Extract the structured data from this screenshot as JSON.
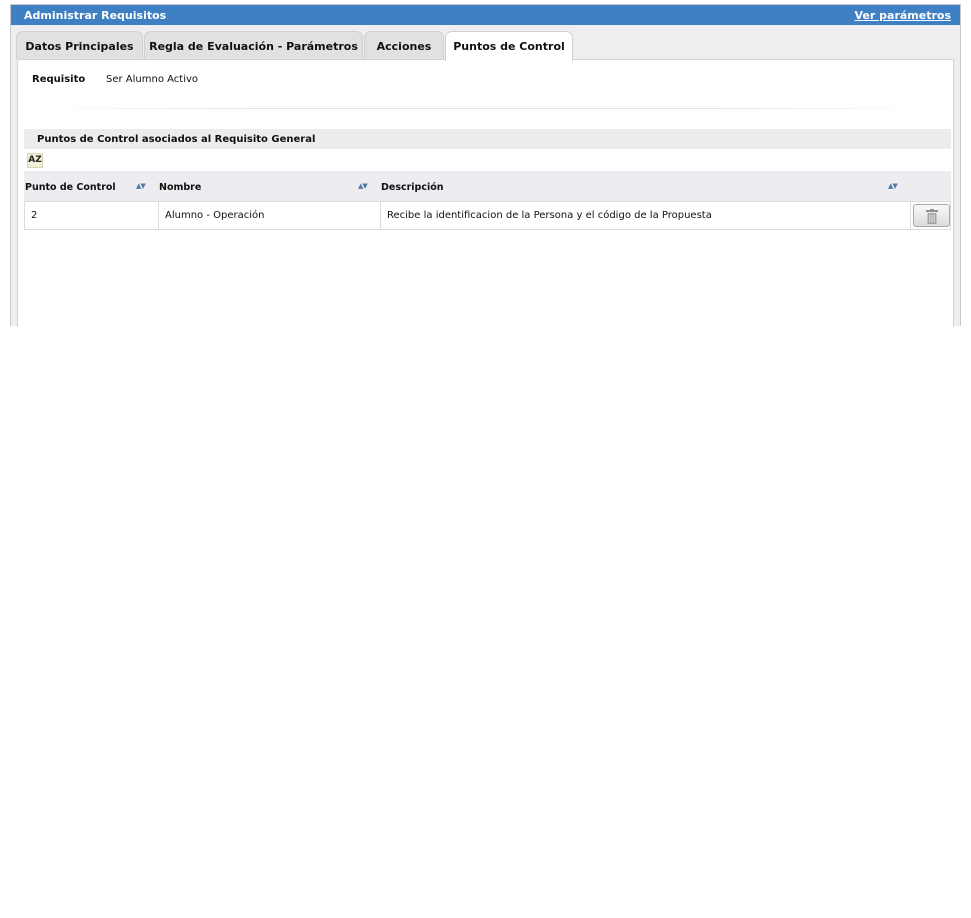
{
  "window": {
    "title": "Administrar Requisitos",
    "link": "Ver parámetros"
  },
  "tabs": [
    {
      "label": "Datos Principales"
    },
    {
      "label": "Regla de Evaluación - Parámetros"
    },
    {
      "label": "Acciones"
    },
    {
      "label": "Puntos de Control",
      "active": true
    }
  ],
  "requisito": {
    "label": "Requisito",
    "value": "Ser Alumno Activo"
  },
  "section": {
    "title": "Puntos de Control asociados al Requisito General",
    "sort_icon": "az-sort-icon",
    "sort_label": "AZ"
  },
  "table": {
    "columns": [
      "Punto de Control",
      "Nombre",
      "Descripción"
    ],
    "sort_glyph": "▲▼",
    "rows": [
      {
        "punto": "2",
        "nombre": "Alumno - Operación",
        "descripcion": "Recibe la identificacion de la Persona y el código de la Propuesta",
        "action_icon": "trash-icon"
      }
    ]
  },
  "colors": {
    "titlebar": "#3f7fc3",
    "sort_arrows": "#4f7aa6"
  }
}
